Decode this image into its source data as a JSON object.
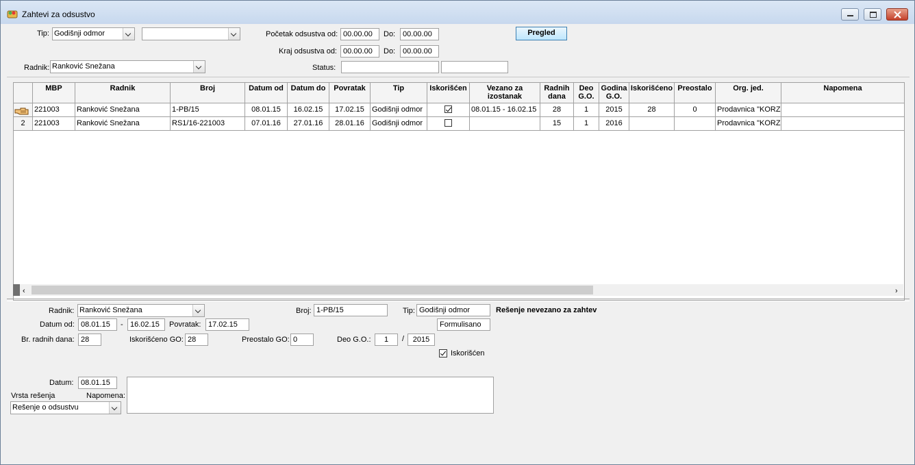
{
  "window": {
    "title": "Zahtevi za odsustvo"
  },
  "filters": {
    "tip_label": "Tip:",
    "tip_value": "Godišnji odmor",
    "tip2_value": "",
    "radnik_label": "Radnik:",
    "radnik_value": "Ranković Snežana",
    "pocetak_label": "Početak odsustva od:",
    "pocetak_od": "00.00.00",
    "do_label": "Do:",
    "pocetak_do": "00.00.00",
    "kraj_label": "Kraj odsustva od:",
    "kraj_od": "00.00.00",
    "kraj_do": "00.00.00",
    "status_label": "Status:",
    "status_value1": "",
    "status_value2": "",
    "pregled_label": "Pregled"
  },
  "grid": {
    "columns": [
      "MBP",
      "Radnik",
      "Broj",
      "Datum od",
      "Datum do",
      "Povratak",
      "Tip",
      "Iskorišćen",
      "Vezano za izostanak",
      "Radnih dana",
      "Deo G.O.",
      "Godina G.O.",
      "Iskorišćeno",
      "Preostalo",
      "Org. jed.",
      "Napomena"
    ],
    "rows": [
      {
        "indicator": "",
        "mbp": "221003",
        "radnik": "Ranković Snežana",
        "broj": "1-PB/15",
        "datum_od": "08.01.15",
        "datum_do": "16.02.15",
        "povratak": "17.02.15",
        "tip": "Godišnji odmor",
        "iskoriscen": true,
        "vezano": "08.01.15 - 16.02.15",
        "radnih_dana": "28",
        "deo_go": "1",
        "godina_go": "2015",
        "iskorisceno": "28",
        "preostalo": "0",
        "org_jed": "Prodavnica \"KORZO",
        "napomena": ""
      },
      {
        "indicator": "2",
        "mbp": "221003",
        "radnik": "Ranković Snežana",
        "broj": "RS1/16-221003",
        "datum_od": "07.01.16",
        "datum_do": "27.01.16",
        "povratak": "28.01.16",
        "tip": "Godišnji odmor",
        "iskoriscen": false,
        "vezano": "",
        "radnih_dana": "15",
        "deo_go": "1",
        "godina_go": "2016",
        "iskorisceno": "",
        "preostalo": "",
        "org_jed": "Prodavnica \"KORZO",
        "napomena": ""
      }
    ]
  },
  "detail": {
    "radnik_label": "Radnik:",
    "radnik_value": "Ranković Snežana",
    "broj_label": "Broj:",
    "broj_value": "1-PB/15",
    "tip_label": "Tip:",
    "tip_value": "Godišnji odmor",
    "resenje_note": "Rešenje nevezano za zahtev",
    "status_value": "Formulisano",
    "datum_od_label": "Datum od:",
    "datum_od": "08.01.15",
    "dash": "-",
    "datum_do": "16.02.15",
    "povratak_label": "Povratak:",
    "povratak": "17.02.15",
    "radnih_dana_label": "Br. radnih dana:",
    "radnih_dana": "28",
    "iskorisceno_label": "Iskorišćeno GO:",
    "iskorisceno": "28",
    "preostalo_label": "Preostalo GO:",
    "preostalo": "0",
    "deo_label": "Deo G.O.:",
    "deo": "1",
    "slash": "/",
    "godina": "2015",
    "iskoriscen_label": "Iskorišćen",
    "datum_label": "Datum:",
    "datum": "08.01.15",
    "vrsta_label": "Vrsta rešenja",
    "vrsta_value": "Rešenje o odsustvu",
    "napomena_label": "Napomena:",
    "napomena_value": ""
  }
}
